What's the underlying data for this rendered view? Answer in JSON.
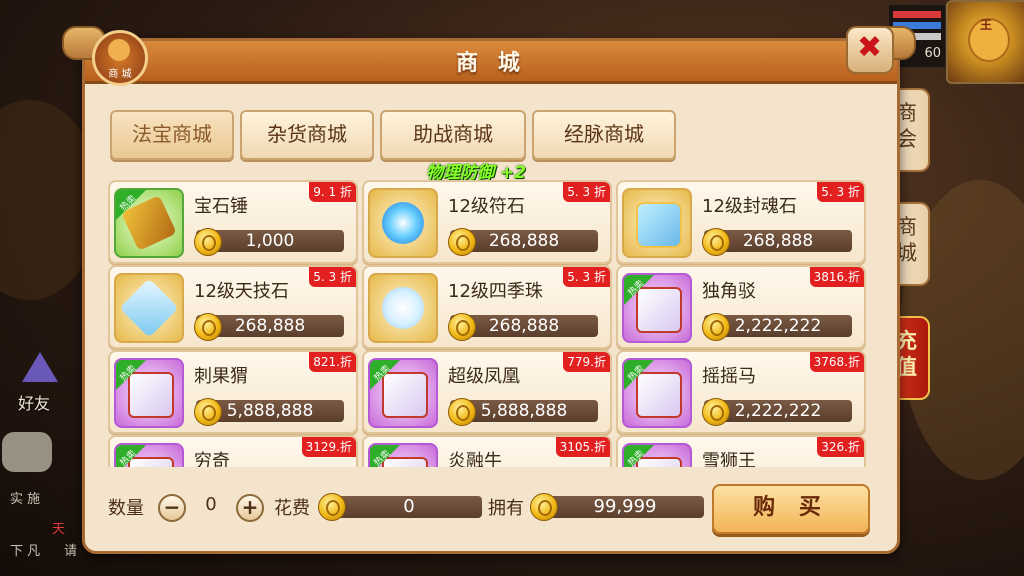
{
  "hud": {
    "level": "60",
    "avatar_glyph": "王",
    "friend_label": "好友",
    "chat_lines": [
      "实 施",
      "天",
      "下 凡",
      "请"
    ]
  },
  "panel": {
    "title": "商 城",
    "badge_label": "商 城",
    "close_icon": "✖"
  },
  "side_tabs": [
    {
      "label": "商会"
    },
    {
      "label": "商城"
    },
    {
      "label": "充值"
    }
  ],
  "categories": [
    {
      "label": "法宝商城",
      "active": true
    },
    {
      "label": "杂货商城",
      "active": false
    },
    {
      "label": "助战商城",
      "active": false
    },
    {
      "label": "经脉商城",
      "active": false
    }
  ],
  "float_text": "物理防御 +2",
  "items": [
    {
      "name": "宝石锤",
      "discount": "9. 1 折",
      "price": "1,000",
      "icon": "hammer-icon",
      "hot": true,
      "frame": "green"
    },
    {
      "name": "12级符石",
      "discount": "5. 3 折",
      "price": "268,888",
      "icon": "blue-orb-icon",
      "hot": false,
      "frame": "gold"
    },
    {
      "name": "12级封魂石",
      "discount": "5. 3 折",
      "price": "268,888",
      "icon": "green-cube-icon",
      "hot": false,
      "frame": "gold"
    },
    {
      "name": "12级天技石",
      "discount": "5. 3 折",
      "price": "268,888",
      "icon": "crystal-icon",
      "hot": false,
      "frame": "gold"
    },
    {
      "name": "12级四季珠",
      "discount": "5. 3 折",
      "price": "268,888",
      "icon": "snow-orb-icon",
      "hot": false,
      "frame": "gold"
    },
    {
      "name": "独角驳",
      "discount": "3816.折",
      "price": "2,222,222",
      "icon": "scroll-icon",
      "hot": true,
      "frame": "purple"
    },
    {
      "name": "刺果猬",
      "discount": "821.折",
      "price": "5,888,888",
      "icon": "scroll-icon",
      "hot": true,
      "frame": "purple"
    },
    {
      "name": "超级凤凰",
      "discount": "779.折",
      "price": "5,888,888",
      "icon": "scroll-icon",
      "hot": true,
      "frame": "purple"
    },
    {
      "name": "摇摇马",
      "discount": "3768.折",
      "price": "2,222,222",
      "icon": "scroll-icon",
      "hot": true,
      "frame": "purple"
    },
    {
      "name": "穷奇",
      "discount": "3129.折",
      "price": "",
      "icon": "scroll-icon",
      "hot": true,
      "frame": "purple"
    },
    {
      "name": "炎融牛",
      "discount": "3105.折",
      "price": "",
      "icon": "scroll-icon",
      "hot": true,
      "frame": "purple"
    },
    {
      "name": "雪狮王",
      "discount": "326.折",
      "price": "",
      "icon": "scroll-icon",
      "hot": true,
      "frame": "purple"
    }
  ],
  "hot_label": "热卖",
  "bottom": {
    "qty_label": "数量",
    "minus": "−",
    "plus": "+",
    "qty_value": "0",
    "cost_label": "花费",
    "cost_value": "0",
    "own_label": "拥有",
    "own_value": "99,999",
    "buy_label": "购 买"
  },
  "colors": {
    "accent": "#b8601e",
    "discount": "#e32020",
    "recharge": "#a8180c"
  }
}
